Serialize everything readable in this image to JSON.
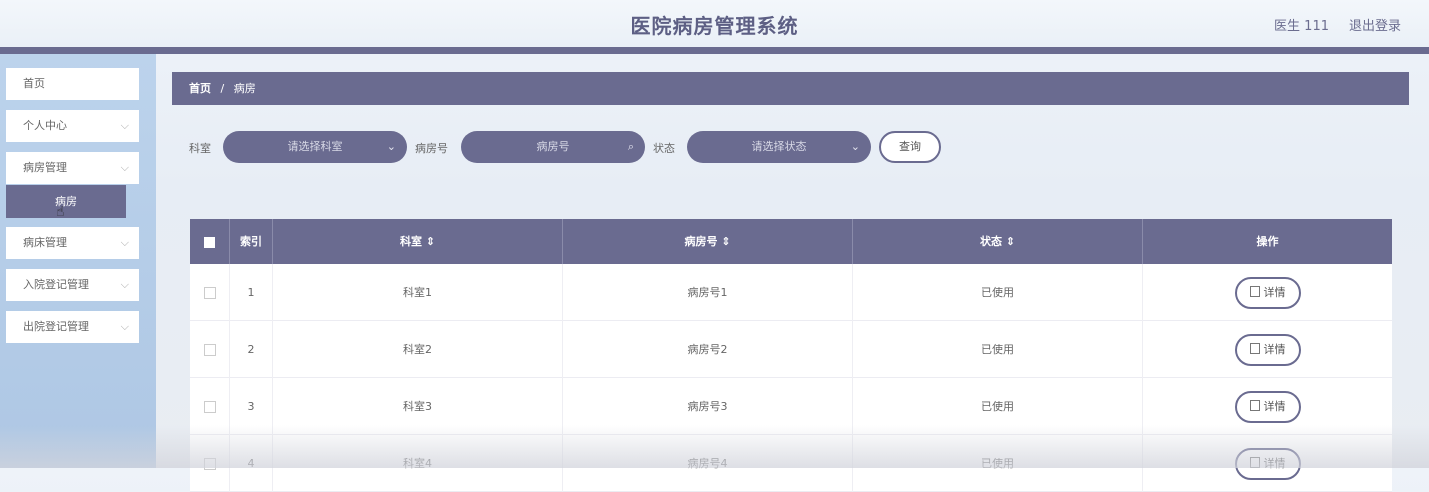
{
  "header": {
    "title": "医院病房管理系统",
    "user": "医生 111",
    "logout": "退出登录"
  },
  "sidebar": {
    "items": [
      {
        "label": "首页"
      },
      {
        "label": "个人中心",
        "chevron": "⌵"
      },
      {
        "label": "病房管理",
        "chevron": "⌵"
      },
      {
        "label": "病床管理",
        "chevron": "⌵"
      },
      {
        "label": "入院登记管理",
        "chevron": "⌵"
      },
      {
        "label": "出院登记管理",
        "chevron": "⌵"
      }
    ],
    "active_sub": "病房"
  },
  "breadcrumb": {
    "home": "首页",
    "sep": "/",
    "current": "病房"
  },
  "filters": {
    "dept_label": "科室",
    "dept_placeholder": "请选择科室",
    "room_label": "病房号",
    "room_placeholder": "病房号",
    "status_label": "状态",
    "status_placeholder": "请选择状态",
    "search_label": "查询"
  },
  "table": {
    "headers": {
      "index": "索引",
      "dept": "科室 ⇕",
      "room": "病房号 ⇕",
      "status": "状态 ⇕",
      "action": "操作"
    },
    "detail_label": "详情",
    "rows": [
      {
        "index": "1",
        "dept": "科室1",
        "room": "病房号1",
        "status": "已使用"
      },
      {
        "index": "2",
        "dept": "科室2",
        "room": "病房号2",
        "status": "已使用"
      },
      {
        "index": "3",
        "dept": "科室3",
        "room": "病房号3",
        "status": "已使用"
      },
      {
        "index": "4",
        "dept": "科室4",
        "room": "病房号4",
        "status": "已使用"
      }
    ]
  },
  "colors": {
    "accent": "#6a6b90",
    "sidebar": "#b5cde9"
  }
}
